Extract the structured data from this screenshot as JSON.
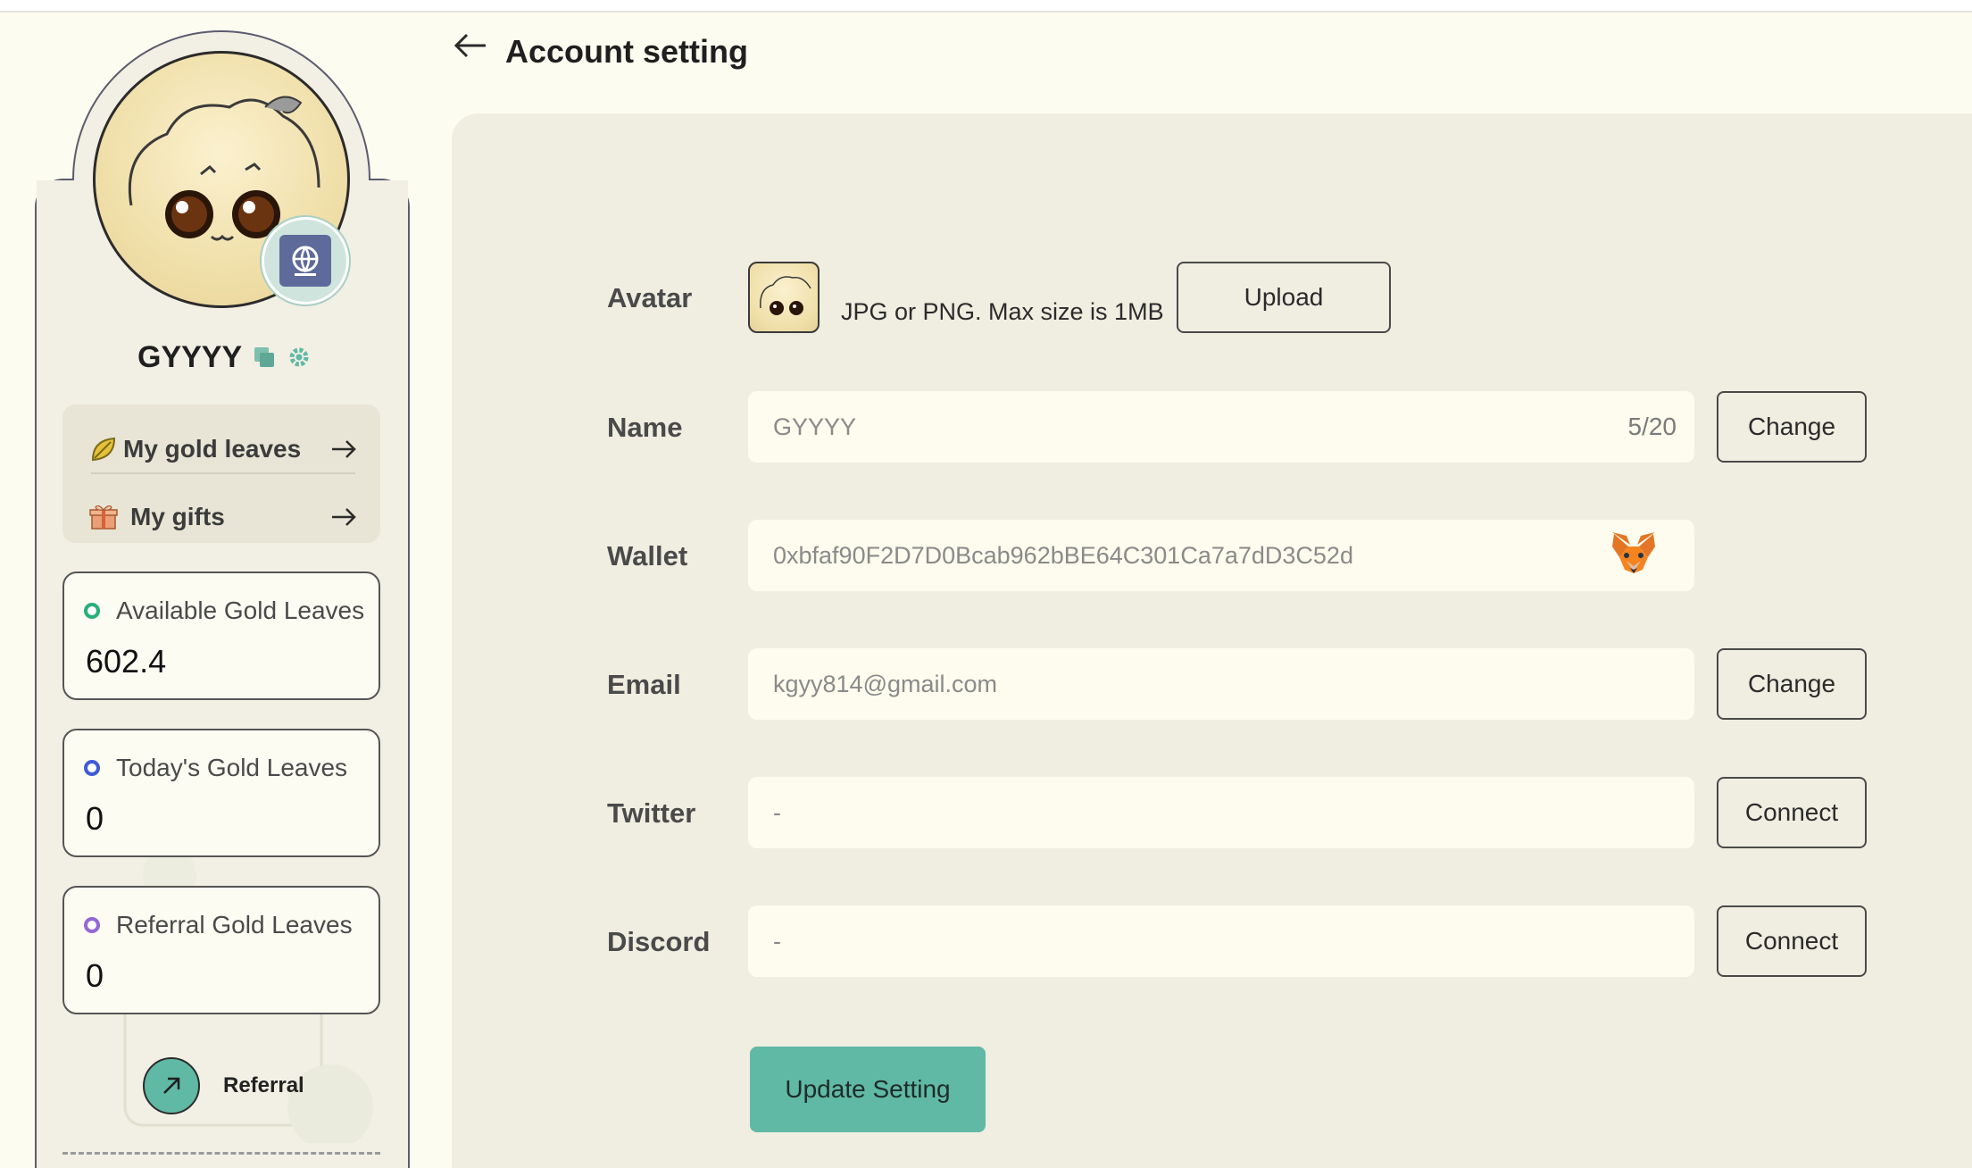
{
  "header": {
    "title": "Account setting"
  },
  "sidebar": {
    "username": "GYYYY",
    "menu": [
      {
        "label": "My gold leaves"
      },
      {
        "label": "My gifts"
      }
    ],
    "stats": [
      {
        "label": "Available Gold Leaves",
        "value": "602.4",
        "dot_color": "#27b07a"
      },
      {
        "label": "Today's Gold Leaves",
        "value": "0",
        "dot_color": "#3f5bd6"
      },
      {
        "label": "Referral Gold Leaves",
        "value": "0",
        "dot_color": "#9467d6"
      }
    ],
    "referral_label": "Referral"
  },
  "form": {
    "avatar": {
      "label": "Avatar",
      "hint": "JPG or PNG. Max size is 1MB",
      "button": "Upload"
    },
    "name": {
      "label": "Name",
      "value": "GYYYY",
      "counter": "5/20",
      "button": "Change"
    },
    "wallet": {
      "label": "Wallet",
      "value": "0xbfaf90F2D7D0Bcab962bBE64C301Ca7a7dD3C52d"
    },
    "email": {
      "label": "Email",
      "value": "kgyy814@gmail.com",
      "button": "Change"
    },
    "twitter": {
      "label": "Twitter",
      "value": "-",
      "button": "Connect"
    },
    "discord": {
      "label": "Discord",
      "value": "-",
      "button": "Connect"
    },
    "submit": "Update Setting"
  },
  "colors": {
    "accent": "#5fb9a5",
    "page_bg": "#fdfcf0",
    "panel_bg": "#f0ede1"
  },
  "icons": [
    "back-arrow-icon",
    "copy-icon",
    "gear-icon",
    "leaf-icon",
    "gift-icon",
    "arrow-right-icon",
    "globe-badge-icon",
    "metamask-fox-icon",
    "arrow-up-right-icon"
  ]
}
